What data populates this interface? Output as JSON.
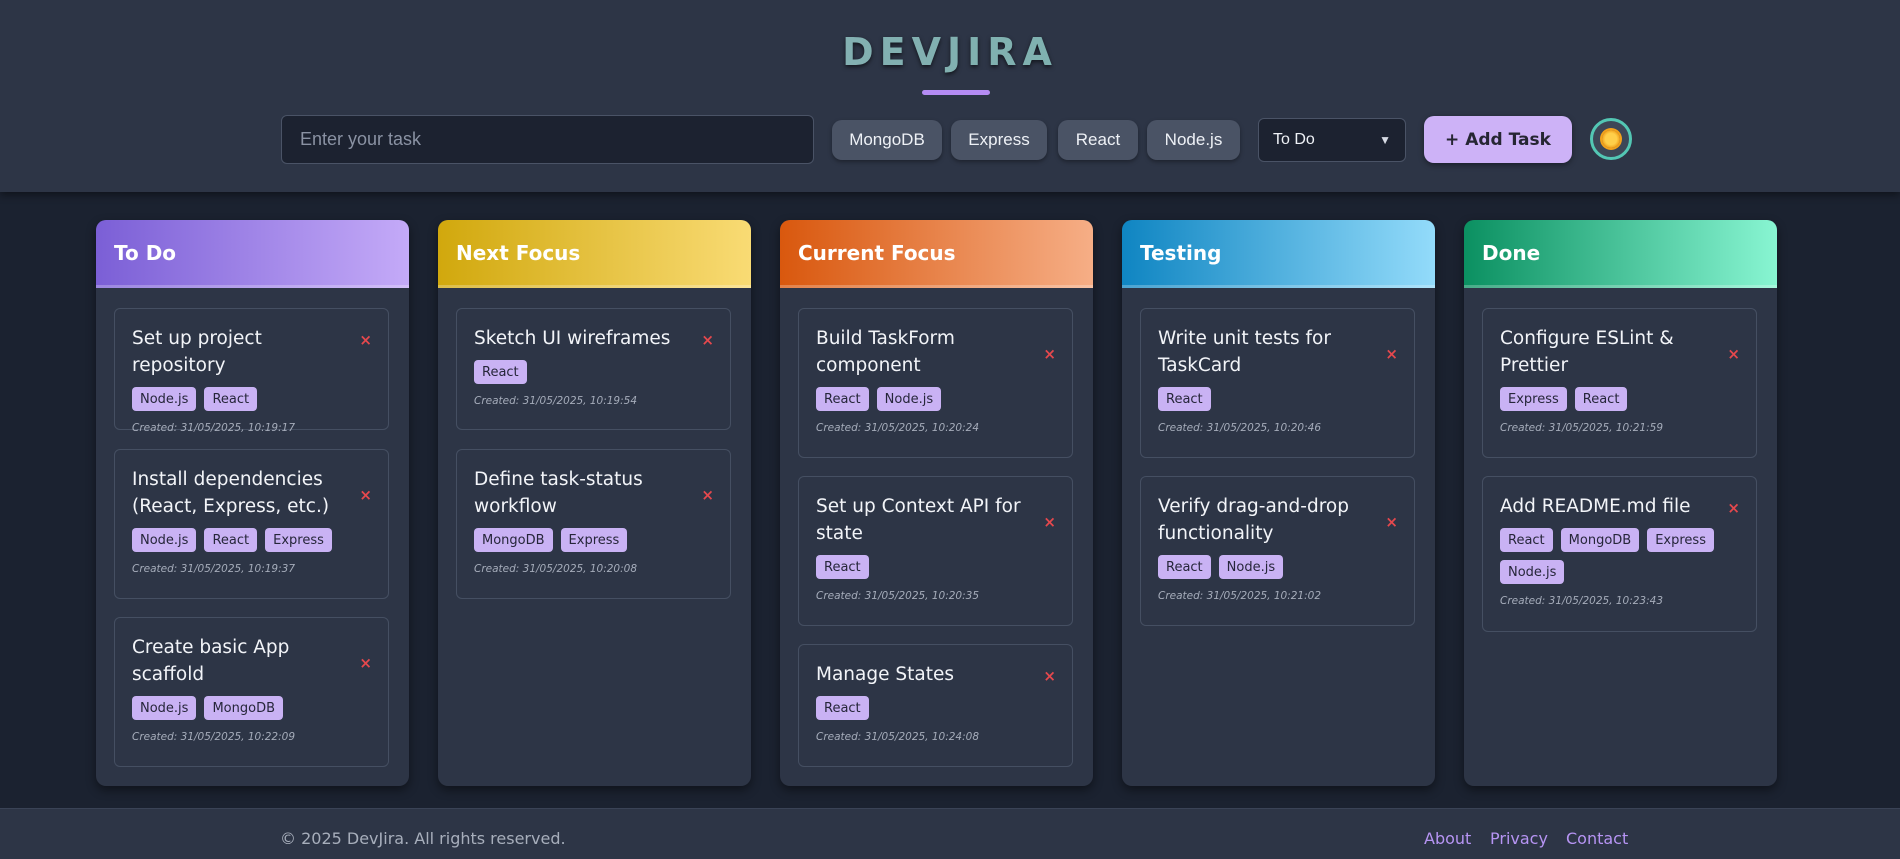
{
  "app": {
    "title": "DEVJIRA"
  },
  "form": {
    "task_placeholder": "Enter your task",
    "tags": [
      "MongoDB",
      "Express",
      "React",
      "Node.js"
    ],
    "status_selected": "To Do",
    "add_label": "+ Add Task"
  },
  "columns": [
    {
      "title": "To Do",
      "cards": [
        {
          "title": "Set up project repository",
          "tags": [
            "Node.js",
            "React"
          ],
          "created": "Created: 31/05/2025, 10:19:17"
        },
        {
          "title": "Install dependencies (React, Express, etc.)",
          "tags": [
            "Node.js",
            "React",
            "Express"
          ],
          "created": "Created: 31/05/2025, 10:19:37"
        },
        {
          "title": "Create basic App scaffold",
          "tags": [
            "Node.js",
            "MongoDB"
          ],
          "created": "Created: 31/05/2025, 10:22:09"
        }
      ]
    },
    {
      "title": "Next Focus",
      "cards": [
        {
          "title": "Sketch UI wireframes",
          "tags": [
            "React"
          ],
          "created": "Created: 31/05/2025, 10:19:54"
        },
        {
          "title": "Define task-status workflow",
          "tags": [
            "MongoDB",
            "Express"
          ],
          "created": "Created: 31/05/2025, 10:20:08"
        }
      ]
    },
    {
      "title": "Current Focus",
      "cards": [
        {
          "title": "Build TaskForm component",
          "tags": [
            "React",
            "Node.js"
          ],
          "created": "Created: 31/05/2025, 10:20:24"
        },
        {
          "title": "Set up Context API for state",
          "tags": [
            "React"
          ],
          "created": "Created: 31/05/2025, 10:20:35"
        },
        {
          "title": "Manage States",
          "tags": [
            "React"
          ],
          "created": "Created: 31/05/2025, 10:24:08"
        }
      ]
    },
    {
      "title": "Testing",
      "cards": [
        {
          "title": "Write unit tests for TaskCard",
          "tags": [
            "React"
          ],
          "created": "Created: 31/05/2025, 10:20:46"
        },
        {
          "title": "Verify drag-and-drop functionality",
          "tags": [
            "React",
            "Node.js"
          ],
          "created": "Created: 31/05/2025, 10:21:02"
        }
      ]
    },
    {
      "title": "Done",
      "cards": [
        {
          "title": "Configure ESLint & Prettier",
          "tags": [
            "Express",
            "React"
          ],
          "created": "Created: 31/05/2025, 10:21:59"
        },
        {
          "title": "Add README.md file",
          "tags": [
            "React",
            "MongoDB",
            "Express",
            "Node.js"
          ],
          "created": "Created: 31/05/2025, 10:23:43"
        }
      ]
    }
  ],
  "card_delete_symbol": "×",
  "footer": {
    "copyright": "© 2025 DevJira. All rights reserved.",
    "links": [
      "About",
      "Privacy",
      "Contact"
    ]
  },
  "colors": {
    "accent": "#b58cf4",
    "tag_bg": "#c9b2f4",
    "delete": "#e5484d",
    "todo_gradient": [
      "#7b5fd6",
      "#c4aaf8"
    ],
    "next_focus_gradient": [
      "#d1a80d",
      "#f9db74"
    ],
    "current_focus_gradient": [
      "#d9580e",
      "#f6ae86"
    ],
    "testing_gradient": [
      "#0f85c2",
      "#93dbfa"
    ],
    "done_gradient": [
      "#0b9061",
      "#88f5d2"
    ]
  }
}
